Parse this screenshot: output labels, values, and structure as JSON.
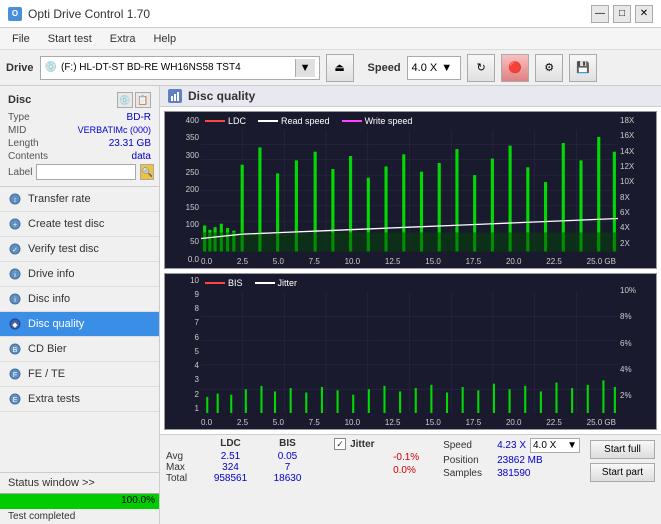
{
  "app": {
    "title": "Opti Drive Control 1.70",
    "icon": "O"
  },
  "titlebar": {
    "minimize": "—",
    "maximize": "□",
    "close": "✕"
  },
  "menubar": {
    "items": [
      "File",
      "Start test",
      "Extra",
      "Help"
    ]
  },
  "drivebar": {
    "drive_label": "Drive",
    "drive_value": "(F:)  HL-DT-ST BD-RE  WH16NS58 TST4",
    "speed_label": "Speed",
    "speed_value": "4.0 X"
  },
  "sidebar": {
    "disc_title": "Disc",
    "disc_fields": [
      {
        "key": "Type",
        "value": "BD-R",
        "blue": true
      },
      {
        "key": "MID",
        "value": "VERBATIMc (000)",
        "blue": true
      },
      {
        "key": "Length",
        "value": "23.31 GB",
        "blue": true
      },
      {
        "key": "Contents",
        "value": "data",
        "blue": true
      },
      {
        "key": "Label",
        "value": "",
        "blue": false
      }
    ],
    "nav_items": [
      {
        "id": "transfer-rate",
        "label": "Transfer rate",
        "active": false
      },
      {
        "id": "create-test-disc",
        "label": "Create test disc",
        "active": false
      },
      {
        "id": "verify-test-disc",
        "label": "Verify test disc",
        "active": false
      },
      {
        "id": "drive-info",
        "label": "Drive info",
        "active": false
      },
      {
        "id": "disc-info",
        "label": "Disc info",
        "active": false
      },
      {
        "id": "disc-quality",
        "label": "Disc quality",
        "active": true
      },
      {
        "id": "cd-bier",
        "label": "CD Bier",
        "active": false
      },
      {
        "id": "fe-te",
        "label": "FE / TE",
        "active": false
      },
      {
        "id": "extra-tests",
        "label": "Extra tests",
        "active": false
      }
    ],
    "status_window": "Status window >>",
    "progress_percent": "100.0%",
    "status_completed": "Test completed"
  },
  "chart": {
    "title": "Disc quality",
    "legend1": [
      {
        "label": "LDC",
        "color": "#ff4444"
      },
      {
        "label": "Read speed",
        "color": "#ffffff"
      },
      {
        "label": "Write speed",
        "color": "#ff44ff"
      }
    ],
    "legend2": [
      {
        "label": "BIS",
        "color": "#ff4444"
      },
      {
        "label": "Jitter",
        "color": "#ffffff"
      }
    ],
    "top_y_labels": [
      "400",
      "350",
      "300",
      "250",
      "200",
      "150",
      "100",
      "50",
      "0.0"
    ],
    "top_y_right_labels": [
      "18X",
      "16X",
      "14X",
      "12X",
      "10X",
      "8X",
      "6X",
      "4X",
      "2X"
    ],
    "top_x_labels": [
      "0.0",
      "2.5",
      "5.0",
      "7.5",
      "10.0",
      "12.5",
      "15.0",
      "17.5",
      "20.0",
      "22.5",
      "25.0 GB"
    ],
    "bottom_y_labels": [
      "10",
      "9",
      "8",
      "7",
      "6",
      "5",
      "4",
      "3",
      "2",
      "1"
    ],
    "bottom_y_right_labels": [
      "10%",
      "8%",
      "6%",
      "4%",
      "2%"
    ],
    "bottom_x_labels": [
      "0.0",
      "2.5",
      "5.0",
      "7.5",
      "10.0",
      "12.5",
      "15.0",
      "17.5",
      "20.0",
      "22.5",
      "25.0 GB"
    ]
  },
  "stats": {
    "headers": [
      "",
      "LDC",
      "BIS"
    ],
    "rows": [
      {
        "label": "Avg",
        "ldc": "2.51",
        "bis": "0.05"
      },
      {
        "label": "Max",
        "ldc": "324",
        "bis": "7"
      },
      {
        "label": "Total",
        "ldc": "958561",
        "bis": "18630"
      }
    ],
    "jitter": {
      "label": "Jitter",
      "checked": true,
      "rows": [
        {
          "key": "",
          "val": "-0.1%"
        },
        {
          "key": "",
          "val": "0.0%"
        },
        {
          "key": "",
          "val": ""
        }
      ]
    },
    "speed": {
      "label": "Speed",
      "current": "4.23 X",
      "select": "4.0 X",
      "position_label": "Position",
      "position_val": "23862 MB",
      "samples_label": "Samples",
      "samples_val": "381590"
    },
    "buttons": {
      "start_full": "Start full",
      "start_part": "Start part"
    }
  },
  "colors": {
    "active_nav": "#3a8ee6",
    "ldc_bar": "#00cc00",
    "bis_bar": "#00cc00",
    "speed_line": "#ffffff",
    "grid_line": "#2a2a4a",
    "chart_bg": "#1a1a2e",
    "progress_fill": "#00cc00"
  }
}
